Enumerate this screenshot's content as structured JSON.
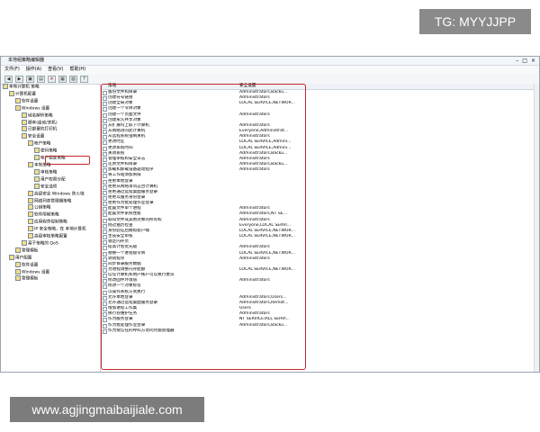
{
  "watermark": {
    "tg": "TG: MYYJJPP",
    "url": "www.agjingmaibaijiale.com"
  },
  "window": {
    "title": "本地组策略编辑器",
    "menu": [
      "文件(F)",
      "操作(A)",
      "查看(V)",
      "帮助(H)"
    ]
  },
  "tree": [
    {
      "label": "本地计算机 策略",
      "lvl": 0
    },
    {
      "label": "计算机配置",
      "lvl": 1
    },
    {
      "label": "软件设置",
      "lvl": 2
    },
    {
      "label": "Windows 设置",
      "lvl": 2
    },
    {
      "label": "域名解析策略",
      "lvl": 3
    },
    {
      "label": "脚本(启动/关机)",
      "lvl": 3
    },
    {
      "label": "已部署的打印机",
      "lvl": 3
    },
    {
      "label": "安全设置",
      "lvl": 3
    },
    {
      "label": "帐户策略",
      "lvl": 4
    },
    {
      "label": "密码策略",
      "lvl": 5
    },
    {
      "label": "帐户锁定策略",
      "lvl": 5
    },
    {
      "label": "本地策略",
      "lvl": 4
    },
    {
      "label": "审核策略",
      "lvl": 5
    },
    {
      "label": "用户权限分配",
      "lvl": 5
    },
    {
      "label": "安全选项",
      "lvl": 5
    },
    {
      "label": "高级安全 Windows 防火墙",
      "lvl": 4
    },
    {
      "label": "网络列表管理器策略",
      "lvl": 4
    },
    {
      "label": "公钥策略",
      "lvl": 4
    },
    {
      "label": "软件限制策略",
      "lvl": 4
    },
    {
      "label": "应用程序控制策略",
      "lvl": 4
    },
    {
      "label": "IP 安全策略，在 本地计算机",
      "lvl": 4
    },
    {
      "label": "高级审核策略配置",
      "lvl": 4
    },
    {
      "label": "基于策略的 QoS",
      "lvl": 3
    },
    {
      "label": "管理模板",
      "lvl": 2
    },
    {
      "label": "用户配置",
      "lvl": 1
    },
    {
      "label": "软件设置",
      "lvl": 2
    },
    {
      "label": "Windows 设置",
      "lvl": 2
    },
    {
      "label": "管理模板",
      "lvl": 2
    }
  ],
  "headers": {
    "policy": "策略",
    "setting": "安全设置"
  },
  "rows": [
    {
      "p": "备份文件和目录",
      "s": "Administrators,Backu..."
    },
    {
      "p": "创建符号链接",
      "s": "Administrators"
    },
    {
      "p": "创建全局对象",
      "s": "LOCAL SERVICE,NETWOR..."
    },
    {
      "p": "创建一个令牌对象",
      "s": ""
    },
    {
      "p": "创建一个页面文件",
      "s": "Administrators"
    },
    {
      "p": "创建永久共享对象",
      "s": ""
    },
    {
      "p": "从扩展坞上取下计算机",
      "s": "Administrators"
    },
    {
      "p": "从网络访问此计算机",
      "s": "Everyone,Administrat..."
    },
    {
      "p": "从远程系统强制关机",
      "s": "Administrators"
    },
    {
      "p": "更改时区",
      "s": "LOCAL SERVICE,Admini..."
    },
    {
      "p": "更改系统时间",
      "s": "LOCAL SERVICE,Admini..."
    },
    {
      "p": "关闭系统",
      "s": "Administrators,Backu..."
    },
    {
      "p": "管理审核和安全日志",
      "s": "Administrators"
    },
    {
      "p": "还原文件和目录",
      "s": "Administrators,Backu..."
    },
    {
      "p": "加载和卸载设备驱动程序",
      "s": "Administrators"
    },
    {
      "p": "将工作站添加到域",
      "s": ""
    },
    {
      "p": "拒绝本地登录",
      "s": ""
    },
    {
      "p": "拒绝从网络访问这台计算机",
      "s": ""
    },
    {
      "p": "拒绝通过远程桌面服务登录",
      "s": ""
    },
    {
      "p": "拒绝以服务身份登录",
      "s": ""
    },
    {
      "p": "拒绝作为批处理作业登录",
      "s": ""
    },
    {
      "p": "配置文件单个进程",
      "s": "Administrators"
    },
    {
      "p": "配置文件系统性能",
      "s": "Administrators,NT SE..."
    },
    {
      "p": "取得文件或其他对象的所有权",
      "s": "Administrators"
    },
    {
      "p": "绕过遍历检查",
      "s": "Everyone,LOCAL SERVI..."
    },
    {
      "p": "身份验证后模拟客户端",
      "s": "LOCAL SERVICE,NETWOR..."
    },
    {
      "p": "生成安全审核",
      "s": "LOCAL SERVICE,NETWOR..."
    },
    {
      "p": "锁定内存页",
      "s": ""
    },
    {
      "p": "提高计划优先级",
      "s": "Administrators"
    },
    {
      "p": "替换一个进程级令牌",
      "s": "LOCAL SERVICE,NETWOR..."
    },
    {
      "p": "调试程序",
      "s": "Administrators"
    },
    {
      "p": "同步目录服务数据",
      "s": ""
    },
    {
      "p": "为进程调整内存配额",
      "s": "LOCAL SERVICE,NETWOR..."
    },
    {
      "p": "信任计算机和用户帐户可以执行委派",
      "s": ""
    },
    {
      "p": "修改固件环境值",
      "s": "Administrators"
    },
    {
      "p": "修改一个对象标签",
      "s": ""
    },
    {
      "p": "以操作系统方式执行",
      "s": ""
    },
    {
      "p": "允许本地登录",
      "s": "Administrators,Users..."
    },
    {
      "p": "允许通过远程桌面服务登录",
      "s": "Administrators,Remot..."
    },
    {
      "p": "增加进程工作集",
      "s": "Users"
    },
    {
      "p": "执行卷维护任务",
      "s": "Administrators"
    },
    {
      "p": "作为服务登录",
      "s": "NT SERVICE\\ALL SERVI..."
    },
    {
      "p": "作为批处理作业登录",
      "s": "Administrators,Backu..."
    },
    {
      "p": "作为受信任的呼叫方访问凭据管理器",
      "s": ""
    }
  ]
}
